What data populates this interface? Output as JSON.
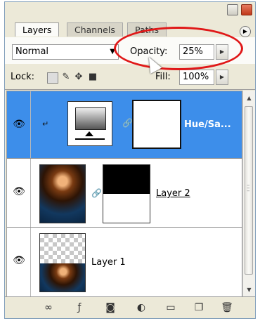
{
  "tabs": [
    {
      "label": "Layers",
      "active": true
    },
    {
      "label": "Channels",
      "active": false
    },
    {
      "label": "Paths",
      "active": false
    }
  ],
  "options": {
    "blend_mode": "Normal",
    "opacity_label": "Opacity:",
    "opacity_value": "25%",
    "lock_label": "Lock:",
    "fill_label": "Fill:",
    "fill_value": "100%"
  },
  "layers": [
    {
      "name": "Hue/Sa...",
      "selected": true,
      "visible": true
    },
    {
      "name": "Layer 2",
      "selected": false,
      "visible": true
    },
    {
      "name": "Layer 1",
      "selected": false,
      "visible": true
    }
  ],
  "colors": {
    "selection": "#3d8eea",
    "highlight_circle": "#e01818"
  },
  "icons": {
    "eye": "eye-icon",
    "chain": "chain-link-icon",
    "panel_menu": "panel-menu-icon"
  }
}
